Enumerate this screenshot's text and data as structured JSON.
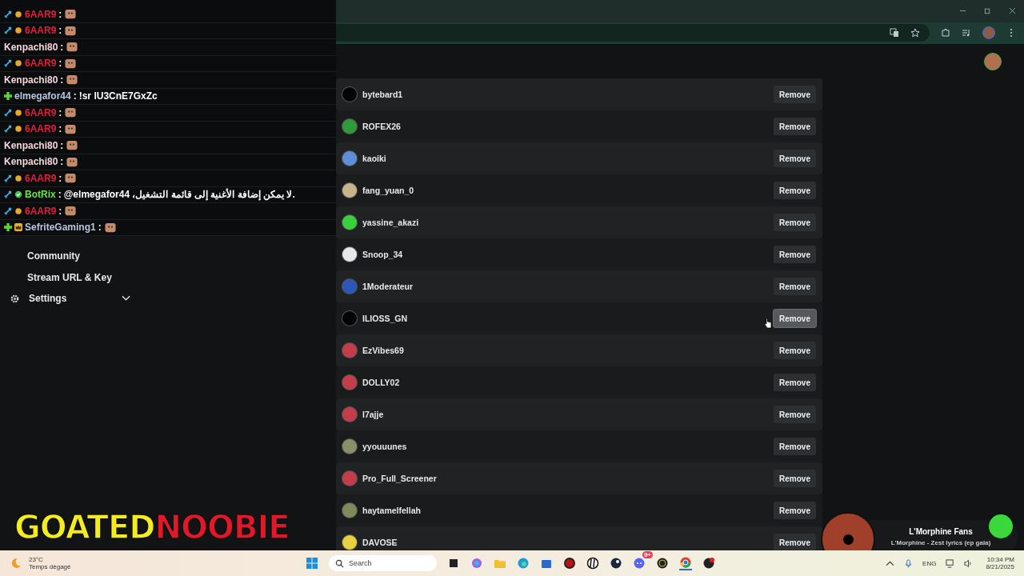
{
  "chat": {
    "messages": [
      {
        "user": "6AAR9",
        "color": "#e0203a",
        "badges": [
          {
            "kind": "sword"
          },
          {
            "kind": "coin"
          }
        ],
        "separator": ":",
        "emote": true
      },
      {
        "user": "6AAR9",
        "color": "#e0203a",
        "badges": [
          {
            "kind": "sword"
          },
          {
            "kind": "coin"
          }
        ],
        "separator": ":",
        "emote": true
      },
      {
        "user": "Kenpachi80",
        "color": "#f3d6dc",
        "separator": ":",
        "emote": true
      },
      {
        "user": "6AAR9",
        "color": "#e0203a",
        "badges": [
          {
            "kind": "sword"
          },
          {
            "kind": "coin"
          }
        ],
        "separator": ":",
        "emote": true
      },
      {
        "user": "Kenpachi80",
        "color": "#f3d6dc",
        "separator": ":",
        "emote": true
      },
      {
        "user": "elmegafor44",
        "color": "#b9c6e0",
        "badges": [
          {
            "kind": "plus"
          }
        ],
        "separator": ":",
        "emote": false,
        "text": "!sr lU3CnE7GxZc"
      },
      {
        "user": "6AAR9",
        "color": "#e0203a",
        "badges": [
          {
            "kind": "sword"
          },
          {
            "kind": "coin"
          }
        ],
        "separator": ":",
        "emote": true
      },
      {
        "user": "6AAR9",
        "color": "#e0203a",
        "badges": [
          {
            "kind": "sword"
          },
          {
            "kind": "coin"
          }
        ],
        "separator": ":",
        "emote": true
      },
      {
        "user": "Kenpachi80",
        "color": "#f3d6dc",
        "separator": ":",
        "emote": true
      },
      {
        "user": "Kenpachi80",
        "color": "#f3d6dc",
        "separator": ":",
        "emote": true
      },
      {
        "user": "6AAR9",
        "color": "#e0203a",
        "badges": [
          {
            "kind": "sword"
          },
          {
            "kind": "coin"
          }
        ],
        "separator": ":",
        "emote": true
      },
      {
        "user": "BotRix",
        "color": "#6ee04a",
        "badges": [
          {
            "kind": "sword"
          },
          {
            "kind": "check"
          }
        ],
        "separator": ":",
        "emote": false,
        "text": "@elmegafor44 ،لا يمكن إضافة الأغنية إلى قائمة التشغيل."
      },
      {
        "user": "6AAR9",
        "color": "#e0203a",
        "badges": [
          {
            "kind": "sword"
          },
          {
            "kind": "coin"
          }
        ],
        "separator": ":",
        "emote": true
      },
      {
        "user": "SefriteGaming1",
        "color": "#b9c6e0",
        "badges": [
          {
            "kind": "plus"
          },
          {
            "kind": "crown"
          }
        ],
        "separator": ":",
        "emote": true
      }
    ]
  },
  "sidebar": {
    "items": [
      {
        "label": "Community",
        "kind": "subitem"
      },
      {
        "label": "Stream URL & Key",
        "kind": "subitem"
      },
      {
        "label": "Settings",
        "kind": "section",
        "expanded": false
      }
    ]
  },
  "logo": {
    "first": "GOATED",
    "second": "NOOBIE"
  },
  "vip_list": {
    "rows": [
      {
        "name": "bytebard1",
        "color": "#050505",
        "button": "Remove",
        "hovered": false
      },
      {
        "name": "ROFEX26",
        "color": "#2f9a3a",
        "button": "Remove",
        "hovered": false
      },
      {
        "name": "kaoiki",
        "color": "#5b8fd6",
        "button": "Remove",
        "hovered": false
      },
      {
        "name": "fang_yuan_0",
        "color": "#c9b48a",
        "button": "Remove",
        "hovered": false
      },
      {
        "name": "yassine_akazi",
        "color": "#38d13c",
        "button": "Remove",
        "hovered": false
      },
      {
        "name": "Snoop_34",
        "color": "#e8e8e8",
        "button": "Remove",
        "hovered": false
      },
      {
        "name": "1Moderateur",
        "color": "#2c56b8",
        "button": "Remove",
        "hovered": false
      },
      {
        "name": "ILIOSS_GN",
        "color": "#050505",
        "button": "Remove",
        "hovered": true
      },
      {
        "name": "EzVibes69",
        "color": "#c33d4a",
        "button": "Remove",
        "hovered": false
      },
      {
        "name": "DOLLY02",
        "color": "#c33d4a",
        "button": "Remove",
        "hovered": false
      },
      {
        "name": "I7ajje",
        "color": "#c33d4a",
        "button": "Remove",
        "hovered": false
      },
      {
        "name": "yyouuunes",
        "color": "#8a8f6a",
        "button": "Remove",
        "hovered": false
      },
      {
        "name": "Pro_Full_Screener",
        "color": "#c33d4a",
        "button": "Remove",
        "hovered": false
      },
      {
        "name": "haytamelfellah",
        "color": "#7d8a5a",
        "button": "Remove",
        "hovered": false
      },
      {
        "name": "DAVOSE",
        "color": "#e8d040",
        "button": "Remove",
        "hovered": false
      }
    ]
  },
  "now_playing": {
    "title": "L'Morphine Fans",
    "subtitle": "L'Morphine - Zest lyrics (ep gala)"
  },
  "taskbar": {
    "weather": {
      "temp": "23°C",
      "condition": "Temps dégagé"
    },
    "search": {
      "placeholder": "Search"
    },
    "discord_badge": "9+",
    "language": "ENG",
    "time": "10:34 PM",
    "date": "8/21/2025"
  }
}
